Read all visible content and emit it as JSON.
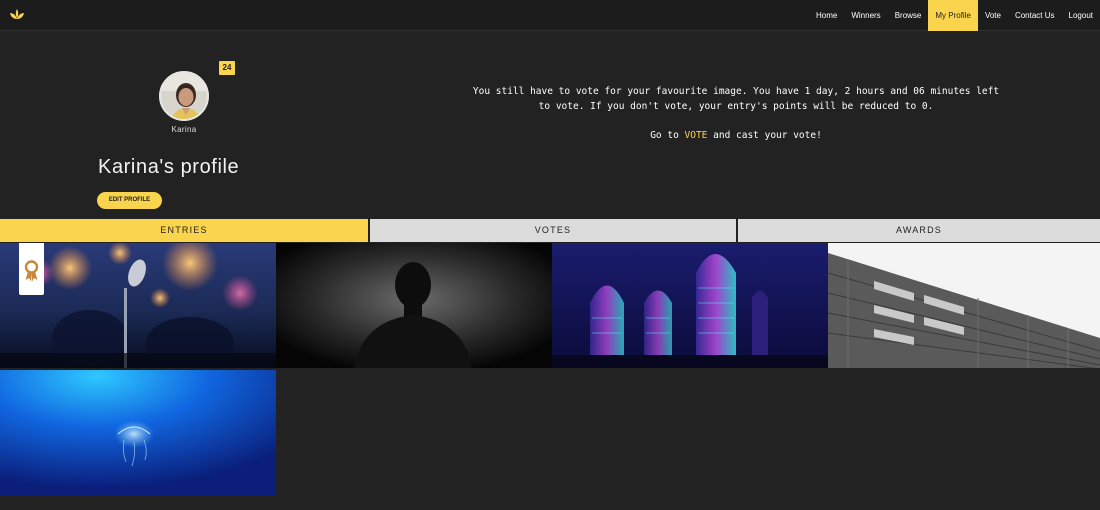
{
  "nav": {
    "logo_icon": "lotus-logo-icon",
    "items": [
      {
        "label": "Home"
      },
      {
        "label": "Winners"
      },
      {
        "label": "Browse"
      },
      {
        "label": "My Profile",
        "active": true
      },
      {
        "label": "Vote"
      },
      {
        "label": "Contact Us"
      },
      {
        "label": "Logout"
      }
    ]
  },
  "profile": {
    "avatar_name": "Karina",
    "badge_count": "24",
    "title": "Karina's profile",
    "edit_button": "EDIT PROFILE"
  },
  "notice": {
    "message": "You still have to vote for your favourite image. You have 1 day, 2 hours and 06 minutes left to vote. If you don't vote, your entry's points will be reduced to 0.",
    "cta_prefix": "Go to ",
    "cta_link": "VOTE",
    "cta_suffix": " and cast your vote!"
  },
  "tabs": [
    {
      "label": "ENTRIES",
      "active": true
    },
    {
      "label": "VOTES"
    },
    {
      "label": "AWARDS"
    }
  ],
  "gallery": {
    "award_icon": "award-medal-icon",
    "images": [
      "concert-microphone-photo",
      "silhouette-portrait-photo",
      "neon-skyscrapers-photo",
      "building-facade-photo",
      "jellyfish-photo"
    ]
  },
  "colors": {
    "accent": "#fbd44d",
    "background": "#222222",
    "tab_inactive": "#dcdcdc"
  }
}
